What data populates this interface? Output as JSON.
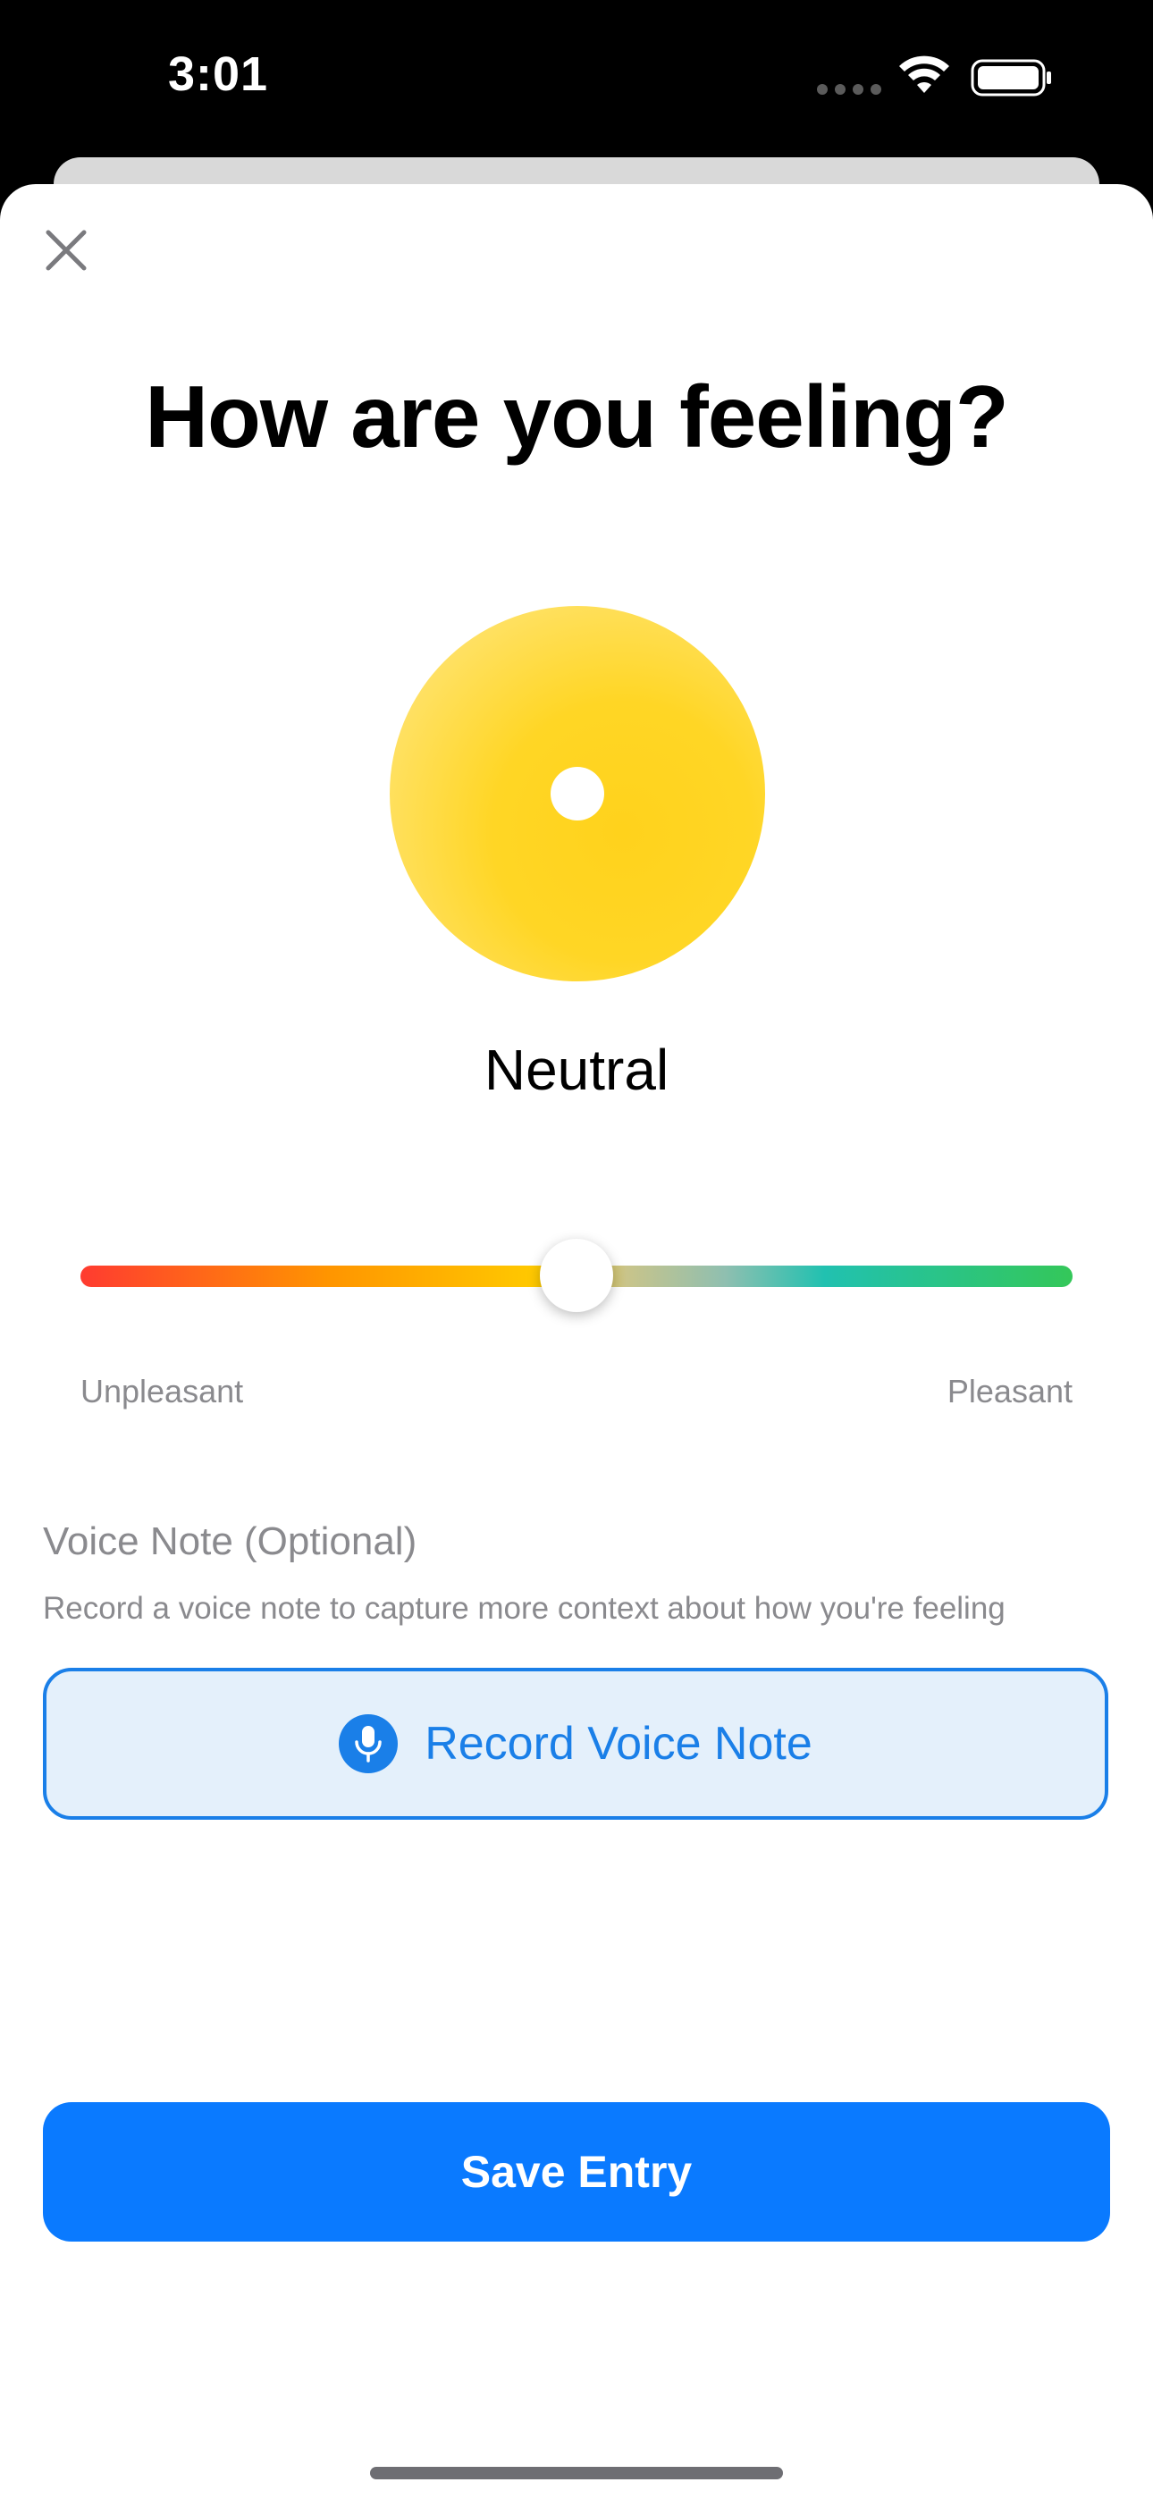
{
  "status_bar": {
    "time": "3:01",
    "icons": [
      "cellular-icon",
      "wifi-icon",
      "battery-icon"
    ]
  },
  "sheet": {
    "close_icon": "close-icon",
    "title": "How are you feeling?"
  },
  "mood": {
    "label": "Neutral",
    "orb_color": "#ffd21c",
    "slider_value_fraction": 0.5,
    "slider_min_label": "Unpleasant",
    "slider_max_label": "Pleasant",
    "gradient_colors": [
      "#ff3b30",
      "#ff9500",
      "#ffcc00",
      "#21c1b0",
      "#34c759"
    ]
  },
  "voice_note": {
    "heading": "Voice Note (Optional)",
    "description": "Record a voice note to capture more context about how you're feeling",
    "button_label": "Record Voice Note",
    "button_icon": "microphone-icon",
    "accent_color": "#1a7fe8"
  },
  "actions": {
    "save_label": "Save Entry",
    "save_color": "#0a7aff"
  }
}
